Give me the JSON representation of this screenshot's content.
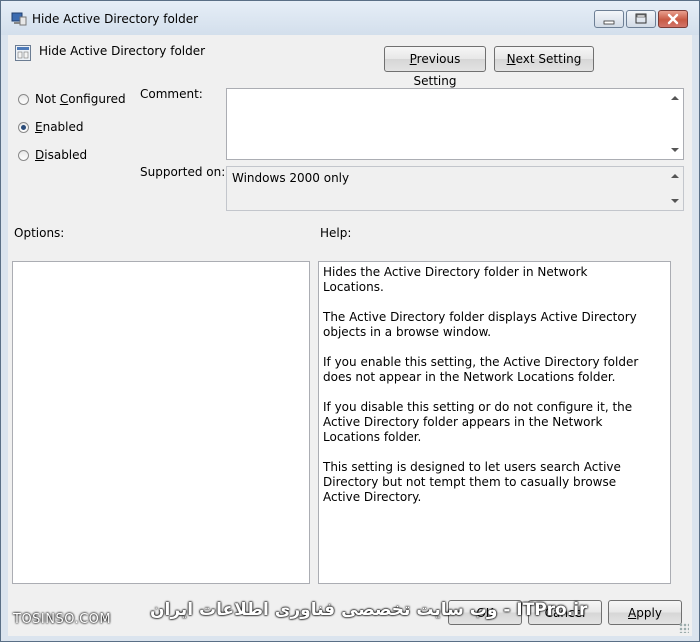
{
  "window": {
    "title": "Hide Active Directory folder",
    "icon": "policy-computer-icon",
    "controls": [
      "minimize-icon",
      "maximize-icon",
      "close-icon"
    ]
  },
  "header": {
    "policy_name": "Hide Active Directory folder",
    "previous_label_pre": "",
    "previous_label_key": "P",
    "previous_label_post": "revious Setting",
    "next_label_pre": "",
    "next_label_key": "N",
    "next_label_post": "ext Setting"
  },
  "state": {
    "options": [
      {
        "pre": "Not ",
        "key": "C",
        "post": "onfigured",
        "selected": false
      },
      {
        "pre": "",
        "key": "E",
        "post": "nabled",
        "selected": true
      },
      {
        "pre": "",
        "key": "D",
        "post": "isabled",
        "selected": false
      }
    ]
  },
  "comment": {
    "label": "Comment:",
    "value": ""
  },
  "supported": {
    "label": "Supported on:",
    "value": "Windows 2000 only"
  },
  "options_panel": {
    "label": "Options:"
  },
  "help_panel": {
    "label": "Help:",
    "paragraphs": [
      "Hides the Active Directory folder in Network Locations.",
      "The Active Directory folder displays Active Directory objects in a browse window.",
      "If you enable this setting, the Active Directory folder does not appear in the Network Locations folder.",
      "If you disable this setting or do not configure it, the Active Directory folder appears in the Network Locations folder.",
      "This setting is designed to let users search Active Directory but not tempt them to casually browse Active Directory."
    ]
  },
  "footer": {
    "ok_label": "OK",
    "cancel_label": "Cancel",
    "apply_pre": "",
    "apply_key": "A",
    "apply_post": "pply"
  },
  "watermark": {
    "left": "TOSINSO.COM",
    "right": "ITPro.ir - وب سایت تخصصی فناوری اطلاعات ایران"
  }
}
